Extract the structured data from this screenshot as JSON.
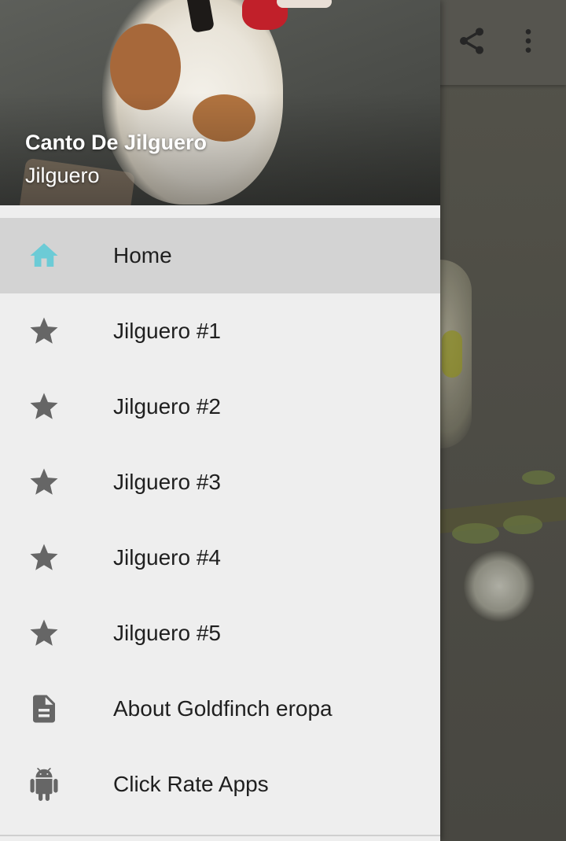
{
  "drawer": {
    "header": {
      "title": "Canto De Jilguero",
      "subtitle": "Jilguero"
    },
    "items": [
      {
        "label": "Home",
        "icon": "home-icon",
        "selected": true
      },
      {
        "label": "Jilguero #1",
        "icon": "star-icon"
      },
      {
        "label": "Jilguero #2",
        "icon": "star-icon"
      },
      {
        "label": "Jilguero #3",
        "icon": "star-icon"
      },
      {
        "label": "Jilguero #4",
        "icon": "star-icon"
      },
      {
        "label": "Jilguero #5",
        "icon": "star-icon"
      },
      {
        "label": "About Goldfinch eropa",
        "icon": "document-icon"
      },
      {
        "label": "Click Rate Apps",
        "icon": "android-icon"
      }
    ]
  },
  "appbar": {
    "actions": [
      "share-icon",
      "more-vert-icon"
    ]
  },
  "colors": {
    "selected_icon": "#6ccbd6",
    "icon_gray": "#666666",
    "selected_bg": "#d3d3d3",
    "drawer_bg": "#eeeeee"
  }
}
